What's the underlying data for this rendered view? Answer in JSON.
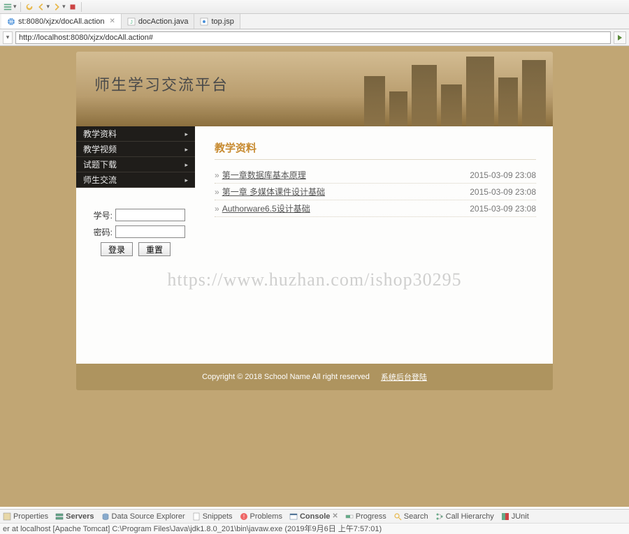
{
  "toolbar": {
    "dd": "▾"
  },
  "tabs": [
    {
      "label": "st:8080/xjzx/docAll.action",
      "icon": "globe",
      "active": true
    },
    {
      "label": "docAction.java",
      "icon": "java",
      "active": false
    },
    {
      "label": "top.jsp",
      "icon": "jsp",
      "active": false
    }
  ],
  "address": {
    "url": "http://localhost:8080/xjzx/docAll.action#",
    "dd": "▾",
    "go": "▶"
  },
  "banner": {
    "title": "师生学习交流平台"
  },
  "sidebar": {
    "items": [
      {
        "label": "教学资料"
      },
      {
        "label": "教学视频"
      },
      {
        "label": "试题下载"
      },
      {
        "label": "师生交流"
      }
    ],
    "arrow": "▸"
  },
  "login": {
    "userLabel": "学号:",
    "pwdLabel": "密码:",
    "loginBtn": "登录",
    "resetBtn": "重置"
  },
  "main": {
    "sectionTitle": "教学资料",
    "bullet": "»",
    "docs": [
      {
        "title": "第一章数据库基本原理",
        "date": "2015-03-09 23:08"
      },
      {
        "title": "第一章 多媒体课件设计基础",
        "date": "2015-03-09 23:08"
      },
      {
        "title": "Authorware6.5设计基础",
        "date": "2015-03-09 23:08"
      }
    ]
  },
  "footer": {
    "copyright": "Copyright © 2018 School Name All right reserved",
    "adminLink": "系统后台登陆"
  },
  "watermark": "https://www.huzhan.com/ishop30295",
  "bottomViews": [
    {
      "label": "Properties",
      "icon": "props"
    },
    {
      "label": "Servers",
      "icon": "servers",
      "bold": true
    },
    {
      "label": "Data Source Explorer",
      "icon": "dse"
    },
    {
      "label": "Snippets",
      "icon": "snip"
    },
    {
      "label": "Problems",
      "icon": "prob"
    },
    {
      "label": "Console",
      "icon": "console",
      "active": true
    },
    {
      "label": "Progress",
      "icon": "prog"
    },
    {
      "label": "Search",
      "icon": "search"
    },
    {
      "label": "Call Hierarchy",
      "icon": "call"
    },
    {
      "label": "JUnit",
      "icon": "junit"
    }
  ],
  "statusLine": "er at localhost [Apache Tomcat] C:\\Program Files\\Java\\jdk1.8.0_201\\bin\\javaw.exe (2019年9月6日 上午7:57:01)"
}
